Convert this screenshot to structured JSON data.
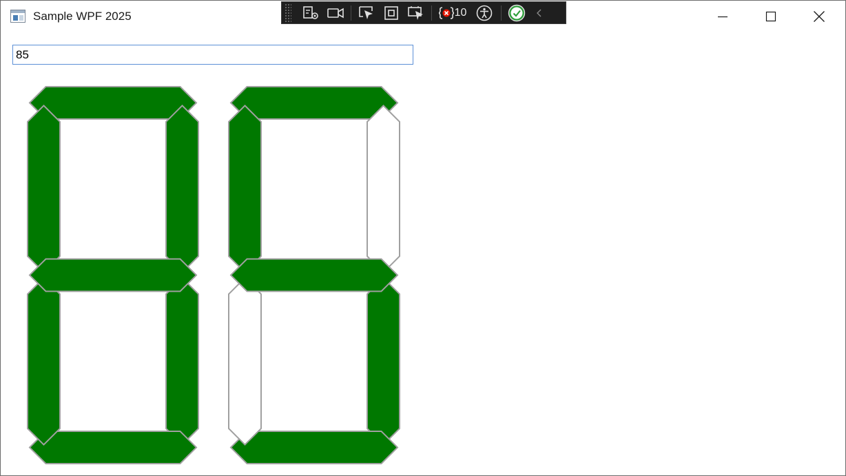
{
  "window": {
    "title": "Sample WPF 2025",
    "controls": [
      "minimize",
      "maximize",
      "close"
    ]
  },
  "debug_toolbar": {
    "items": [
      {
        "icon": "live-visual-tree-icon"
      },
      {
        "icon": "record-camera-icon"
      },
      {
        "icon": "select-element-icon"
      },
      {
        "icon": "display-layout-adorners-icon"
      },
      {
        "icon": "track-focus-icon"
      },
      {
        "icon": "binding-failures-icon",
        "count": "10"
      },
      {
        "icon": "accessibility-icon"
      },
      {
        "icon": "hot-reload-ok-icon"
      },
      {
        "icon": "collapse-chevron-icon"
      }
    ]
  },
  "input": {
    "value": "85"
  },
  "seven_segment": {
    "on_color": "#007800",
    "off_color": "#ffffff",
    "outline_color": "#a0a0a0",
    "digits": [
      {
        "digit": "8",
        "segments": {
          "a": true,
          "b": true,
          "c": true,
          "d": true,
          "e": true,
          "f": true,
          "g": true
        }
      },
      {
        "digit": "5",
        "segments": {
          "a": true,
          "b": false,
          "c": true,
          "d": true,
          "e": false,
          "f": true,
          "g": true
        }
      }
    ]
  }
}
